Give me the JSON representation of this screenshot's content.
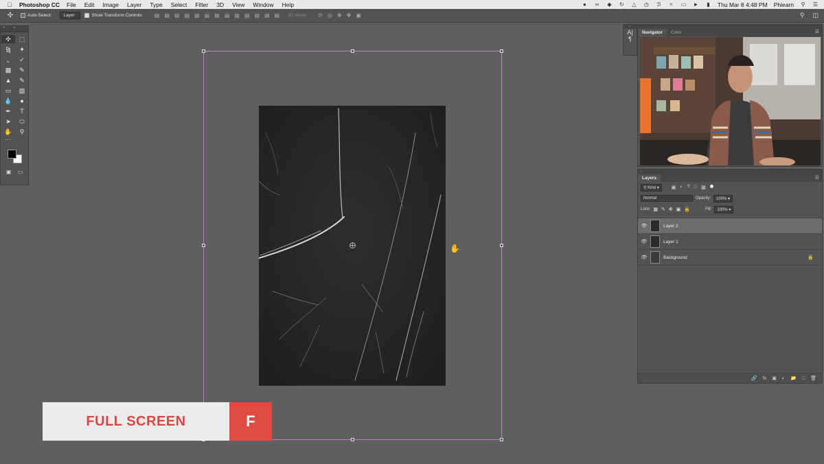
{
  "menubar": {
    "app_name": "Photoshop CC",
    "items": [
      "File",
      "Edit",
      "Image",
      "Layer",
      "Type",
      "Select",
      "Filter",
      "3D",
      "View",
      "Window",
      "Help"
    ],
    "datetime": "Thu Mar 8  4:48 PM",
    "user": "Phlearn"
  },
  "options": {
    "auto_select_label": "Auto-Select:",
    "auto_select_value": "Layer",
    "show_transform_label": "Show Transform Controls",
    "mode_3d_label": "3D Mode:"
  },
  "navigator": {
    "tabs": [
      "Navigator",
      "Color"
    ]
  },
  "layers_panel": {
    "title": "Layers",
    "filter_kind": "Kind",
    "blend_mode": "Normal",
    "opacity_label": "Opacity:",
    "opacity_value": "100%",
    "lock_label": "Lock:",
    "fill_label": "Fill:",
    "fill_value": "100%",
    "layers": [
      {
        "name": "Layer 2",
        "selected": true
      },
      {
        "name": "Layer 1",
        "selected": false
      },
      {
        "name": "Background",
        "selected": false,
        "locked": true
      }
    ]
  },
  "banner": {
    "label": "FULL SCREEN",
    "key": "F"
  },
  "colors": {
    "banner_red": "#e04a40",
    "banner_text_red": "#d9463f",
    "transform_border": "#c27bcb",
    "workspace_bg": "#5f5f5f"
  }
}
